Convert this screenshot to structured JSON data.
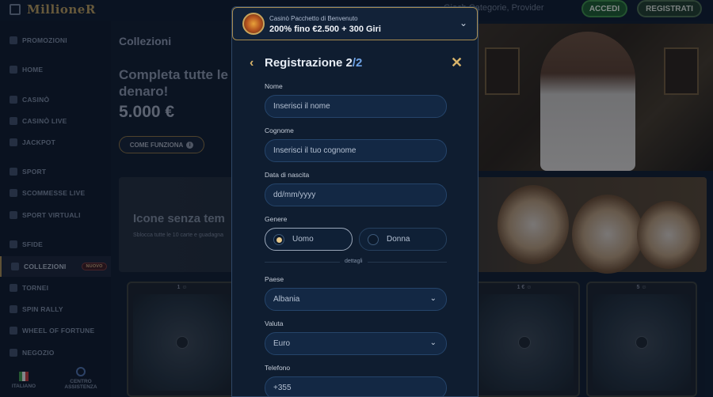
{
  "header": {
    "brand": "MillioneR",
    "search_placeholder": "Gioch Categorie, Provider",
    "login_label": "ACCEDI",
    "register_label": "REGISTRATI"
  },
  "sidebar": {
    "items": [
      {
        "label": "PROMOZIONI",
        "icon": "megaphone-icon"
      },
      {
        "label": "HOME",
        "icon": "home-icon"
      },
      {
        "label": "CASINÒ",
        "icon": "diamond-icon"
      },
      {
        "label": "CASINÒ LIVE",
        "icon": "live-casino-icon"
      },
      {
        "label": "JACKPOT",
        "icon": "jackpot-icon"
      },
      {
        "label": "SPORT",
        "icon": "soccer-ball-icon"
      },
      {
        "label": "SCOMMESSE LIVE",
        "icon": "live-bet-icon"
      },
      {
        "label": "SPORT VIRTUALI",
        "icon": "virtual-sport-icon"
      },
      {
        "label": "SFIDE",
        "icon": "swords-icon"
      },
      {
        "label": "COLLEZIONI",
        "icon": "collection-icon",
        "badge": "NUOVO"
      },
      {
        "label": "TORNEI",
        "icon": "trophy-icon"
      },
      {
        "label": "SPIN RALLY",
        "icon": "spin-icon"
      },
      {
        "label": "WHEEL OF FORTUNE",
        "icon": "wheel-icon"
      },
      {
        "label": "NEGOZIO",
        "icon": "shop-icon"
      }
    ],
    "language": "ITALIANO",
    "support": "CENTRO ASSISTENZA"
  },
  "main": {
    "title": "Collezioni",
    "promo_text_1": "Completa tutte le",
    "promo_text_2": "denaro!",
    "promo_amount": "5.000 €",
    "how_it_works": "COME FUNZIONA",
    "icone_title": "Icone senza tem",
    "icone_sub": "Sblocca tutte le 10 carte e guadagna",
    "tiles": [
      {
        "label": "1 ☺"
      },
      {
        "label": "1 € ☺"
      },
      {
        "label": "5 ☺"
      }
    ]
  },
  "modal": {
    "bonus_sub": "Casinò Pacchetto di Benvenuto",
    "bonus_main": "200% fino €2.500 + 300 Giri",
    "title": "Registrazione 2",
    "title_step": "/2",
    "fields": {
      "nome_label": "Nome",
      "nome_placeholder": "Inserisci il nome",
      "cognome_label": "Cognome",
      "cognome_placeholder": "Inserisci il tuo cognome",
      "nascita_label": "Data di nascita",
      "nascita_placeholder": "dd/mm/yyyy",
      "genere_label": "Genere",
      "gender_male": "Uomo",
      "gender_female": "Donna",
      "divider": "dettagli",
      "paese_label": "Paese",
      "paese_value": "Albania",
      "valuta_label": "Valuta",
      "valuta_value": "Euro",
      "telefono_label": "Telefono",
      "telefono_value": "+355"
    },
    "selected_gender": "Uomo"
  },
  "colors": {
    "gold_accent": "#d8b46a",
    "step_blue": "#6fa3e6",
    "login_green": "#1d5c2c"
  }
}
